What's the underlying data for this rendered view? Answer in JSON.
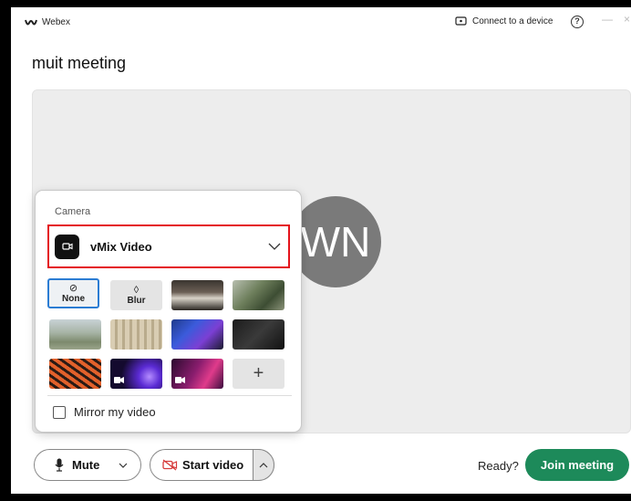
{
  "titlebar": {
    "app_name": "Webex",
    "connect_label": "Connect to a device",
    "help_glyph": "?",
    "minimize_glyph": "—",
    "close_glyph": "×"
  },
  "meeting": {
    "title": "muit meeting",
    "avatar_initials": "WN"
  },
  "camera_popup": {
    "section_label": "Camera",
    "selected_camera": "vMix Video",
    "backgrounds": [
      {
        "label": "None",
        "icon": "no-background-icon",
        "selected": true
      },
      {
        "label": "Blur",
        "icon": "blur-drop-icon",
        "selected": false
      },
      {
        "label": "",
        "icon": "office-image",
        "selected": false
      },
      {
        "label": "",
        "icon": "garden-image",
        "selected": false
      },
      {
        "label": "",
        "icon": "landscape-image",
        "selected": false
      },
      {
        "label": "",
        "icon": "blinds-image",
        "selected": false
      },
      {
        "label": "",
        "icon": "blue-purple-waves-image",
        "selected": false
      },
      {
        "label": "",
        "icon": "dark-abstract-image",
        "selected": false
      },
      {
        "label": "",
        "icon": "orange-texture-image",
        "selected": false
      },
      {
        "label": "",
        "icon": "purple-video-background",
        "selected": false
      },
      {
        "label": "",
        "icon": "pink-video-background",
        "selected": false
      },
      {
        "label": "+",
        "icon": "add-icon",
        "selected": false
      }
    ],
    "mirror_label": "Mirror my video",
    "mirror_checked": false
  },
  "controls": {
    "mute_label": "Mute",
    "start_video_label": "Start video",
    "ready_label": "Ready?",
    "join_label": "Join meeting"
  },
  "colors": {
    "join_green": "#1d8a5a",
    "highlight_red": "#e4131b",
    "selected_blue": "#2b7cd3",
    "video_off_red": "#d63a3a"
  }
}
